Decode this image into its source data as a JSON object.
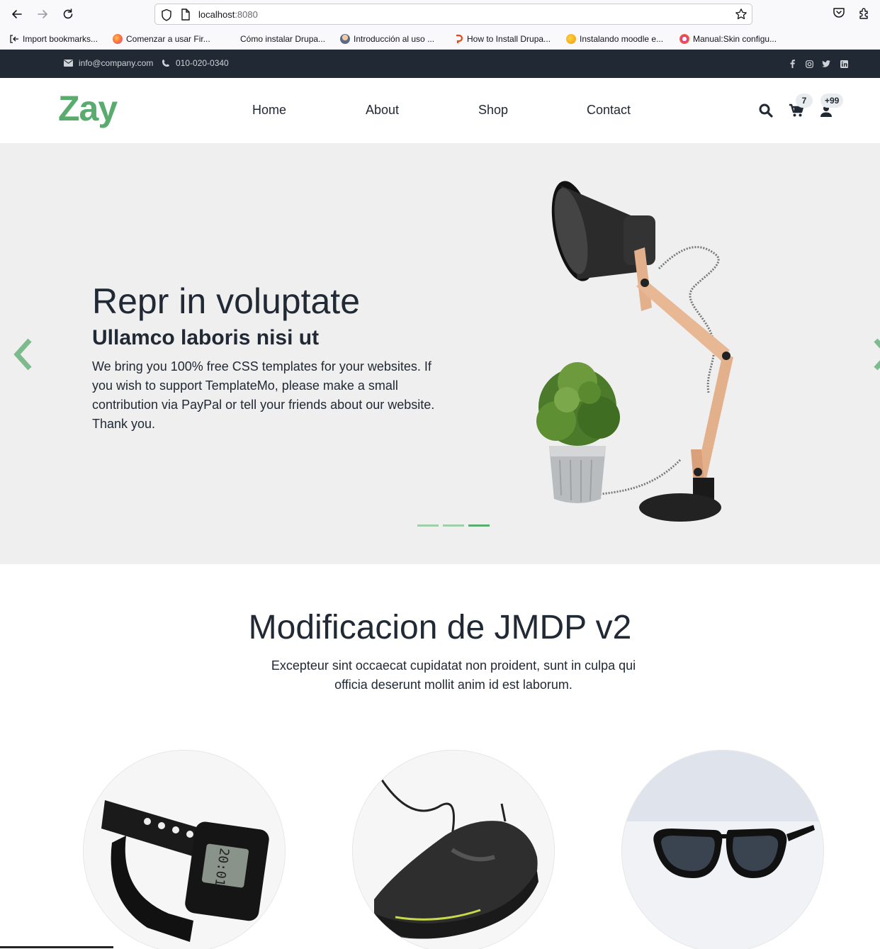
{
  "browser": {
    "url_host": "localhost",
    "url_port": ":8080",
    "bookmarks": [
      {
        "label": "Import bookmarks...",
        "icon": "import-icon"
      },
      {
        "label": "Comenzar a usar Fir...",
        "icon": "firefox-icon"
      },
      {
        "label": "Cómo instalar Drupa...",
        "icon": "none"
      },
      {
        "label": "Introducción al uso ...",
        "icon": "avatar-icon"
      },
      {
        "label": "How to Install Drupa...",
        "icon": "drupal-icon"
      },
      {
        "label": "Instalando moodle e...",
        "icon": "moodle-icon"
      },
      {
        "label": "Manual:Skin configu...",
        "icon": "mediawiki-icon"
      }
    ]
  },
  "topbar": {
    "email": "info@company.com",
    "phone": "010-020-0340",
    "social": [
      "facebook-icon",
      "instagram-icon",
      "twitter-icon",
      "linkedin-icon"
    ]
  },
  "header": {
    "logo": "Zay",
    "nav": [
      "Home",
      "About",
      "Shop",
      "Contact"
    ],
    "cart_count": "7",
    "user_count": "+99"
  },
  "hero": {
    "title": "Repr in voluptate",
    "subtitle": "Ullamco laboris nisi ut",
    "text": "We bring you 100% free CSS templates for your websites. If you wish to support TemplateMo, please make a small contribution via PayPal or tell your friends about our website. Thank you.",
    "slides": 3,
    "active_slide": 3
  },
  "categories": {
    "title": "Modificacion de JMDP v2",
    "description": "Excepteur sint occaecat cupidatat non proident, sunt in culpa qui officia deserunt mollit anim id est laborum.",
    "items": [
      "watch-image",
      "sneaker-image",
      "sunglasses-image"
    ]
  },
  "colors": {
    "brand": "#59ab6e",
    "dark": "#212934",
    "hero_bg": "#efefef"
  }
}
